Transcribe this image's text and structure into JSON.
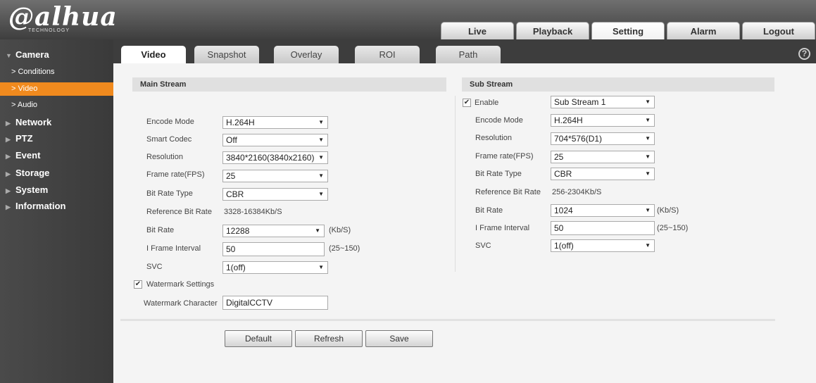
{
  "header": {
    "logo": "alhua",
    "logo_sub": "TECHNOLOGY",
    "tabs": [
      "Live",
      "Playback",
      "Setting",
      "Alarm",
      "Logout"
    ],
    "active_tab": "Setting"
  },
  "sidebar": {
    "camera": "Camera",
    "sub": [
      "Conditions",
      "Video",
      "Audio"
    ],
    "active_sub": "Video",
    "items": [
      "Network",
      "PTZ",
      "Event",
      "Storage",
      "System",
      "Information"
    ]
  },
  "tabs": [
    "Video",
    "Snapshot",
    "Overlay",
    "ROI",
    "Path"
  ],
  "active_tab": "Video",
  "main": {
    "title": "Main Stream",
    "encode_mode_label": "Encode Mode",
    "encode_mode": "H.264H",
    "smart_codec_label": "Smart Codec",
    "smart_codec": "Off",
    "resolution_label": "Resolution",
    "resolution": "3840*2160(3840x2160)",
    "frame_rate_label": "Frame rate(FPS)",
    "frame_rate": "25",
    "bit_rate_type_label": "Bit Rate Type",
    "bit_rate_type": "CBR",
    "ref_bit_rate_label": "Reference Bit Rate",
    "ref_bit_rate": "3328-16384Kb/S",
    "bit_rate_label": "Bit Rate",
    "bit_rate": "12288",
    "bit_rate_unit": "(Kb/S)",
    "iframe_label": "I Frame Interval",
    "iframe": "50",
    "iframe_range": "(25~150)",
    "svc_label": "SVC",
    "svc": "1(off)",
    "watermark_label": "Watermark Settings",
    "watermark_char_label": "Watermark Character",
    "watermark_char": "DigitalCCTV"
  },
  "sub": {
    "title": "Sub Stream",
    "enable_label": "Enable",
    "stream": "Sub Stream 1",
    "encode_mode_label": "Encode Mode",
    "encode_mode": "H.264H",
    "resolution_label": "Resolution",
    "resolution": "704*576(D1)",
    "frame_rate_label": "Frame rate(FPS)",
    "frame_rate": "25",
    "bit_rate_type_label": "Bit Rate Type",
    "bit_rate_type": "CBR",
    "ref_bit_rate_label": "Reference Bit Rate",
    "ref_bit_rate": "256-2304Kb/S",
    "bit_rate_label": "Bit Rate",
    "bit_rate": "1024",
    "bit_rate_unit": "(Kb/S)",
    "iframe_label": "I Frame Interval",
    "iframe": "50",
    "iframe_range": "(25~150)",
    "svc_label": "SVC",
    "svc": "1(off)"
  },
  "buttons": {
    "default": "Default",
    "refresh": "Refresh",
    "save": "Save"
  },
  "colors": {
    "accent": "#f08a1e",
    "sidebar": "#404040",
    "section": "#e0e0e0"
  }
}
